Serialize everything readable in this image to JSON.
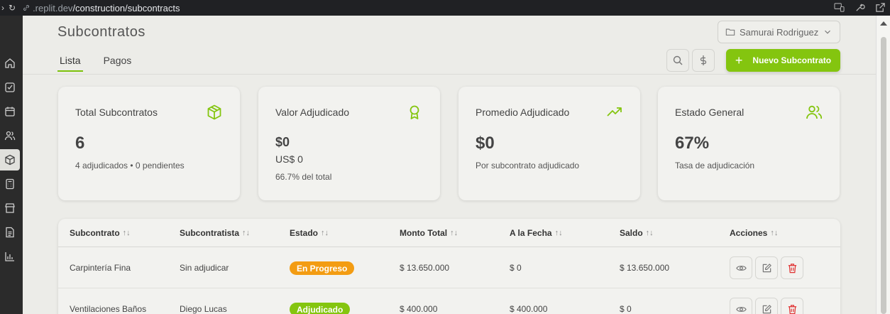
{
  "browser": {
    "url_host": ".replit.dev",
    "url_path": "/construction/subcontracts"
  },
  "header": {
    "title": "Subcontratos",
    "project_selector": "Samurai Rodriguez"
  },
  "tabs": [
    {
      "label": "Lista",
      "active": true
    },
    {
      "label": "Pagos",
      "active": false
    }
  ],
  "toolbar": {
    "new_button_label": "Nuevo Subcontrato"
  },
  "colors": {
    "accent": "#84c50f",
    "badge_in_progress": "#f39c12",
    "badge_awarded": "#84c50f",
    "delete": "#e03131"
  },
  "cards": [
    {
      "title": "Total Subcontratos",
      "icon": "box-icon",
      "value": "6",
      "note": "4 adjudicados • 0 pendientes"
    },
    {
      "title": "Valor Adjudicado",
      "icon": "award-icon",
      "value": "$0",
      "value2": "US$ 0",
      "note": "66.7% del total"
    },
    {
      "title": "Promedio Adjudicado",
      "icon": "trending-up-icon",
      "value": "$0",
      "note": "Por subcontrato adjudicado"
    },
    {
      "title": "Estado General",
      "icon": "users-icon",
      "value": "67%",
      "note": "Tasa de adjudicación"
    }
  ],
  "table": {
    "columns": [
      "Subcontrato",
      "Subcontratista",
      "Estado",
      "Monto Total",
      "A la Fecha",
      "Saldo",
      "Acciones"
    ],
    "sort_glyph": "↑↓",
    "rows": [
      {
        "subcontrato": "Carpintería Fina",
        "subcontratista": "Sin adjudicar",
        "estado": "En Progreso",
        "monto": "$ 13.650.000",
        "fecha": "$ 0",
        "saldo": "$ 13.650.000"
      },
      {
        "subcontrato": "Ventilaciones Baños",
        "subcontratista": "Diego Lucas",
        "estado": "Adjudicado",
        "monto": "$ 400.000",
        "fecha": "$ 400.000",
        "saldo": "$ 0"
      }
    ]
  }
}
